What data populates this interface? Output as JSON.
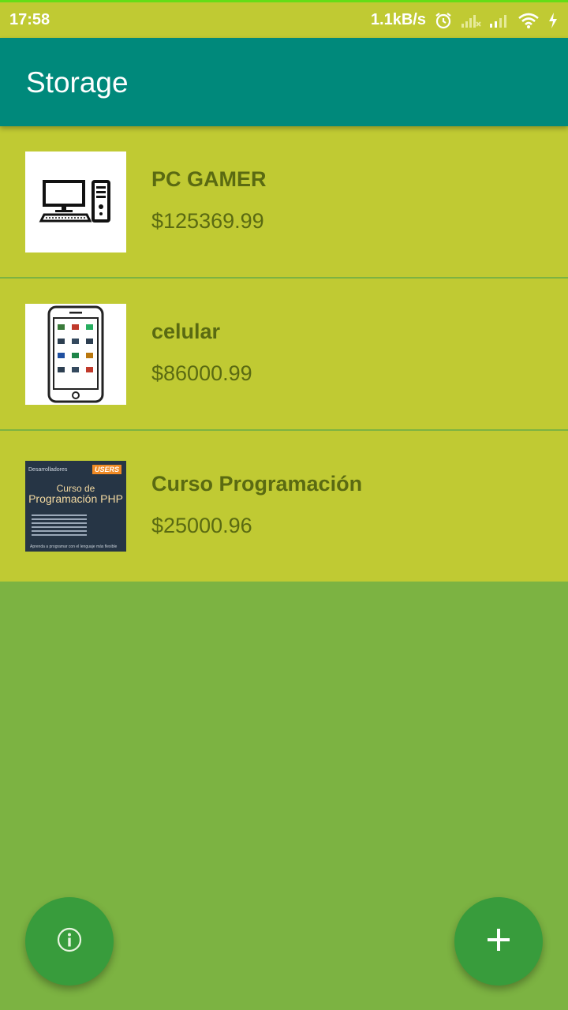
{
  "status_bar": {
    "time": "17:58",
    "net_speed": "1.1kB/s"
  },
  "app_bar": {
    "title": "Storage"
  },
  "items": [
    {
      "name": "PC GAMER",
      "price": "$125369.99",
      "image_icon": "desktop-computer-icon"
    },
    {
      "name": "celular",
      "price": "$86000.99",
      "image_icon": "smartphone-icon"
    },
    {
      "name": "Curso Programación",
      "price": "$25000.96",
      "image_icon": "book-cover"
    }
  ],
  "book_cover": {
    "top_text": "Desarrolladores",
    "badge": "USERS",
    "title_line1": "Curso de",
    "title_line2": "Programación PHP",
    "footer": "Aprenda a programar con el lenguaje más flexible"
  },
  "fabs": {
    "info_icon": "info-icon",
    "add_icon": "plus-icon"
  },
  "colors": {
    "status_bar": "#c0ca33",
    "app_bar": "#00897b",
    "list_item": "#c0ca33",
    "background": "#7cb342",
    "fab": "#389c3c",
    "text": "#5a6a12"
  }
}
